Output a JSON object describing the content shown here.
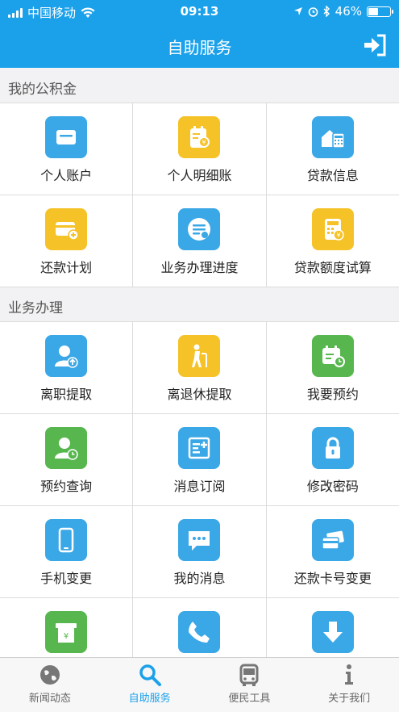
{
  "status": {
    "carrier": "中国移动",
    "time": "09:13",
    "battery": "46%"
  },
  "header": {
    "title": "自助服务"
  },
  "section1": {
    "title": "我的公积金",
    "items": [
      {
        "label": "个人账户",
        "color": "blue",
        "icon": "card-icon"
      },
      {
        "label": "个人明细账",
        "color": "yellow",
        "icon": "ledger-icon"
      },
      {
        "label": "贷款信息",
        "color": "blue",
        "icon": "house-calc-icon"
      },
      {
        "label": "还款计划",
        "color": "yellow",
        "icon": "card-plus-icon"
      },
      {
        "label": "业务办理进度",
        "color": "blue",
        "icon": "progress-icon"
      },
      {
        "label": "贷款额度试算",
        "color": "yellow",
        "icon": "calculator-icon"
      }
    ]
  },
  "section2": {
    "title": "业务办理",
    "items": [
      {
        "label": "离职提取",
        "color": "blue",
        "icon": "user-upload-icon"
      },
      {
        "label": "离退休提取",
        "color": "yellow",
        "icon": "elder-icon"
      },
      {
        "label": "我要预约",
        "color": "green",
        "icon": "calendar-clock-icon"
      },
      {
        "label": "预约查询",
        "color": "green",
        "icon": "user-clock-icon"
      },
      {
        "label": "消息订阅",
        "color": "blue",
        "icon": "subscribe-icon"
      },
      {
        "label": "修改密码",
        "color": "blue",
        "icon": "lock-icon"
      },
      {
        "label": "手机变更",
        "color": "blue",
        "icon": "phone-icon"
      },
      {
        "label": "我的消息",
        "color": "blue",
        "icon": "message-icon"
      },
      {
        "label": "还款卡号变更",
        "color": "blue",
        "icon": "card-swap-icon"
      },
      {
        "label": "",
        "color": "green",
        "icon": "atm-icon"
      },
      {
        "label": "",
        "color": "blue",
        "icon": "call-icon"
      },
      {
        "label": "",
        "color": "blue",
        "icon": "download-icon"
      }
    ]
  },
  "tabs": [
    {
      "label": "新闻动态",
      "icon": "globe-icon",
      "active": false
    },
    {
      "label": "自助服务",
      "icon": "search-icon",
      "active": true
    },
    {
      "label": "便民工具",
      "icon": "bus-icon",
      "active": false
    },
    {
      "label": "关于我们",
      "icon": "info-icon",
      "active": false
    }
  ],
  "colors": {
    "accent": "#1ba1ea",
    "tile_blue": "#3aa7e6",
    "tile_yellow": "#f5c227",
    "tile_green": "#57b74e"
  }
}
